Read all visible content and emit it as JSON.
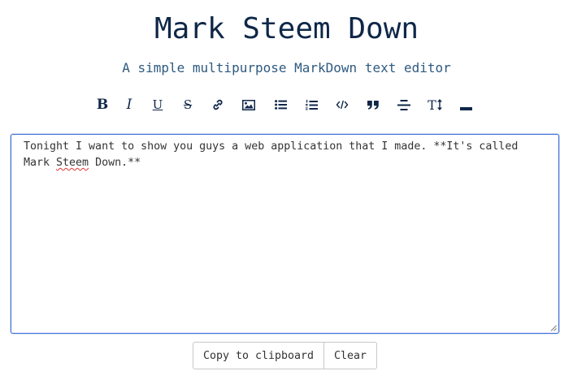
{
  "header": {
    "title": "Mark Steem Down",
    "subtitle": "A simple multipurpose MarkDown text editor"
  },
  "toolbar": {
    "tools": [
      {
        "name": "bold",
        "icon": "bold-icon",
        "glyph": "B"
      },
      {
        "name": "italic",
        "icon": "italic-icon",
        "glyph": "I"
      },
      {
        "name": "underline",
        "icon": "underline-icon",
        "glyph": "U"
      },
      {
        "name": "strikethrough",
        "icon": "strikethrough-icon",
        "glyph": "S"
      },
      {
        "name": "link",
        "icon": "link-icon"
      },
      {
        "name": "image",
        "icon": "image-icon"
      },
      {
        "name": "bulleted-list",
        "icon": "bulleted-list-icon"
      },
      {
        "name": "numbered-list",
        "icon": "numbered-list-icon"
      },
      {
        "name": "code",
        "icon": "code-icon"
      },
      {
        "name": "quote",
        "icon": "quote-icon"
      },
      {
        "name": "center-align",
        "icon": "center-align-icon"
      },
      {
        "name": "text-size",
        "icon": "text-size-icon",
        "glyph": "T"
      },
      {
        "name": "horizontal-rule",
        "icon": "horizontal-rule-icon"
      }
    ]
  },
  "editor": {
    "text_before": "Tonight I want to show you guys a web application that I made. **It's called\nMark ",
    "text_misspelled": "Steem",
    "text_after": " Down.**"
  },
  "actions": {
    "copy_label": "Copy to clipboard",
    "clear_label": "Clear"
  },
  "colors": {
    "title": "#0f2748",
    "subtitle": "#2e5a80",
    "focus_border": "#3f6fd8"
  }
}
